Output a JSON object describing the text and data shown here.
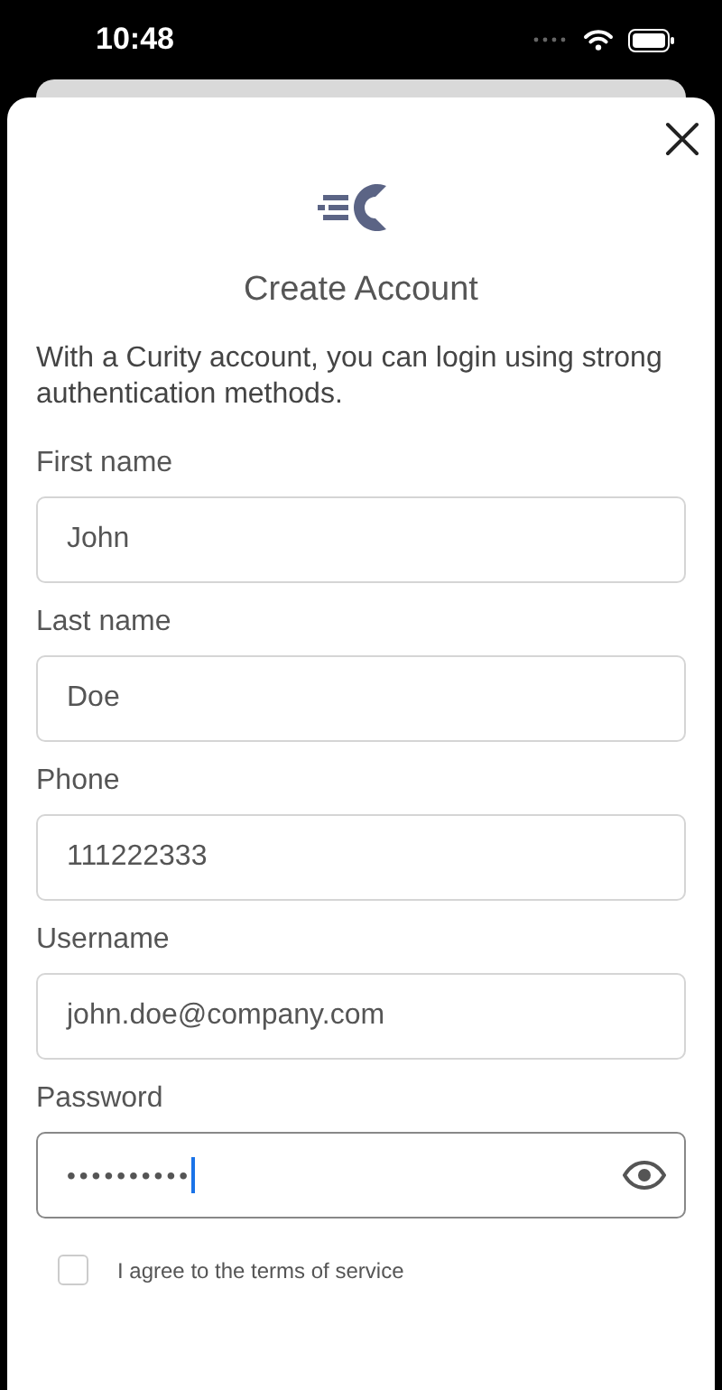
{
  "status_bar": {
    "time": "10:48"
  },
  "sheet": {
    "title": "Create Account",
    "description": "With a Curity account, you can login using strong authentication methods."
  },
  "fields": [
    {
      "label": "First name",
      "value": "John",
      "focused": false,
      "kind": "text"
    },
    {
      "label": "Last name",
      "value": "Doe",
      "focused": false,
      "kind": "text"
    },
    {
      "label": "Phone",
      "value": "111222333",
      "focused": false,
      "kind": "text"
    },
    {
      "label": "Username",
      "value": "john.doe@company.com",
      "focused": false,
      "kind": "text"
    },
    {
      "label": "Password",
      "value": "••••••••••",
      "focused": true,
      "kind": "password"
    }
  ],
  "terms": {
    "label": "I agree to the terms of service",
    "checked": false
  }
}
